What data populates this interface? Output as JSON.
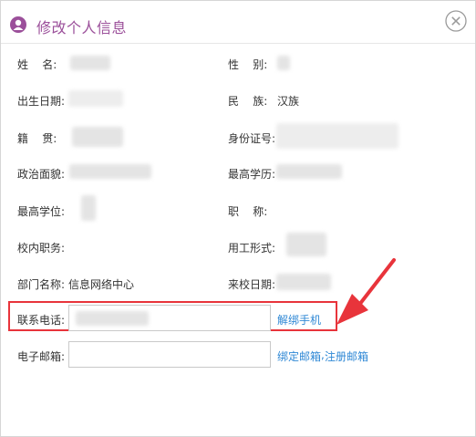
{
  "dialog": {
    "title": "修改个人信息",
    "icons": {
      "title": "user-icon",
      "close": "close-circle-icon"
    },
    "accent_color": "#9b4f9a"
  },
  "fields": {
    "name_label": "姓    名:",
    "gender_label": "性    别:",
    "birthdate_label": "出生日期:",
    "ethnicity_label": "民    族:",
    "ethnicity_value": "汉族",
    "native_place_label": "籍    贯:",
    "id_number_label": "身份证号:",
    "political_status_label": "政治面貌:",
    "education_label": "最高学历:",
    "degree_label": "最高学位:",
    "title_label": "职    称:",
    "campus_position_label": "校内职务:",
    "employment_form_label": "用工形式:",
    "department_label": "部门名称:",
    "department_value": "信息网络中心",
    "join_date_label": "来校日期:"
  },
  "contact": {
    "phone_label": "联系电话:",
    "unbind_phone_link": "解绑手机",
    "email_label": "电子邮箱:",
    "email_value": "",
    "bind_email_link": "绑定邮箱",
    "separator": ",",
    "register_email_link": "注册邮箱",
    "highlight_color": "#e8343b",
    "link_color": "#2f88d5"
  }
}
